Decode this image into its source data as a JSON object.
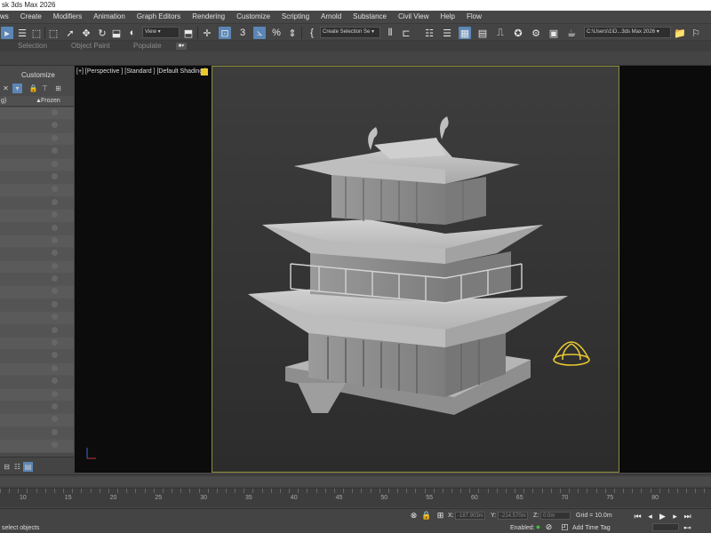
{
  "window": {
    "title": "sk 3ds Max 2026"
  },
  "menu": [
    "ws",
    "Create",
    "Modifiers",
    "Animation",
    "Graph Editors",
    "Rendering",
    "Customize",
    "Scripting",
    "Arnold",
    "Substance",
    "Civil View",
    "Help",
    "Flow"
  ],
  "toolbar": {
    "view_dropdown": "View",
    "selection_set_dropdown": "Create Selection Se",
    "path_field": "C:\\Users\\1\\D...3ds Max 2026"
  },
  "ribbon": {
    "tabs": [
      "Selection",
      "Object Paint",
      "Populate"
    ]
  },
  "scene_explorer": {
    "panel_title": "Customize",
    "col_name": "g)",
    "col_frozen": "Frozen",
    "row_count": 27
  },
  "viewport": {
    "label": "[+] [Perspective ] [Standard ] [Default Shading ]",
    "accent_color": "#e8c830"
  },
  "timeline": {
    "ticks": [
      "10",
      "15",
      "20",
      "25",
      "30",
      "35",
      "40",
      "45",
      "50",
      "55",
      "60",
      "65",
      "70",
      "75",
      "80"
    ]
  },
  "status": {
    "message": "select objects",
    "x_label": "X:",
    "x_value": "-187.903m",
    "y_label": "Y:",
    "y_value": "-214.570m",
    "z_label": "Z:",
    "z_value": "0.0m",
    "grid": "Grid = 10.0m",
    "enabled_label": "Enabled:",
    "add_time_tag": "Add Time Tag"
  }
}
